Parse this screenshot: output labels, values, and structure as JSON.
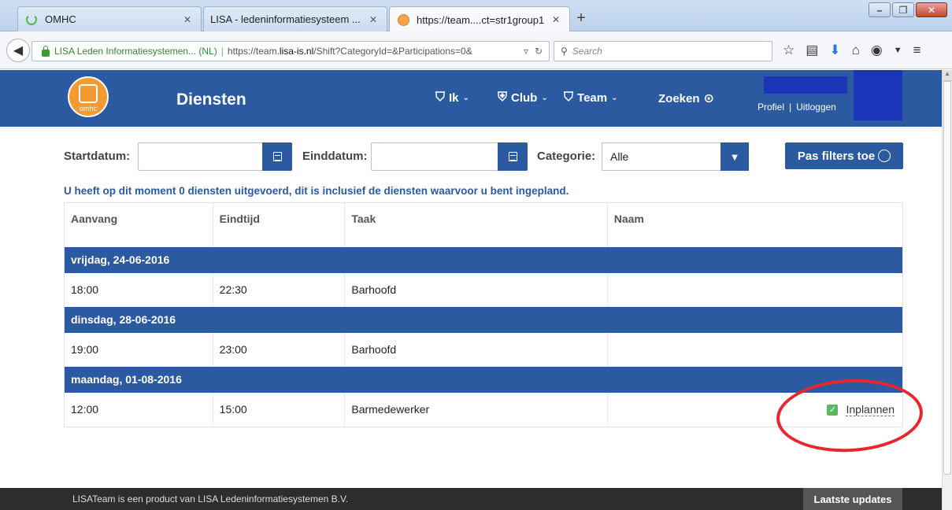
{
  "browser": {
    "tabs": [
      {
        "label": "OMHC",
        "icon": "loading-spinner-icon"
      },
      {
        "label": "LISA - ledeninformatiesysteem ...",
        "icon": "none"
      },
      {
        "label": "https://team....ct=str1group1",
        "icon": "omhc-favicon"
      }
    ],
    "new_tab": "+",
    "site_identity": "LISA Leden Informatiesystemen... (NL)",
    "url_prefix": "https://team.",
    "url_domain": "lisa-is.nl",
    "url_rest": "/Shift?CategoryId=&Participations=0&",
    "search_placeholder": "Search"
  },
  "header": {
    "logo_text": "omhc",
    "page_title": "Diensten",
    "menu": [
      {
        "label": "Ik",
        "icon": "shirt-icon"
      },
      {
        "label": "Club",
        "icon": "shield-icon"
      },
      {
        "label": "Team",
        "icon": "team-shirts-icon"
      }
    ],
    "search_label": "Zoeken",
    "profile": "Profiel",
    "separator": "|",
    "logout": "Uitloggen"
  },
  "filters": {
    "start_label": "Startdatum:",
    "start_value": "",
    "end_label": "Einddatum:",
    "end_value": "",
    "category_label": "Categorie:",
    "category_value": "Alle",
    "apply_label": "Pas filters toe"
  },
  "notice": "U heeft op dit moment 0 diensten uitgevoerd, dit is inclusief de diensten waarvoor u bent ingepland.",
  "table": {
    "headers": [
      "Aanvang",
      "Eindtijd",
      "Taak",
      "Naam"
    ],
    "groups": [
      {
        "date": "vrijdag, 24-06-2016",
        "start": "18:00",
        "end": "22:30",
        "task": "Barhoofd",
        "name": ""
      },
      {
        "date": "dinsdag, 28-06-2016",
        "start": "19:00",
        "end": "23:00",
        "task": "Barhoofd",
        "name": ""
      },
      {
        "date": "maandag, 01-08-2016",
        "start": "12:00",
        "end": "15:00",
        "task": "Barmedewerker",
        "name": "",
        "action": "Inplannen"
      }
    ]
  },
  "footer": {
    "text": "LISATeam is een product van LISA Ledeninformatiesystemen B.V.",
    "button": "Laatste updates"
  },
  "colors": {
    "brand_blue": "#2b5aa0",
    "logo_orange": "#f39a33",
    "annotation_red": "#e8262b",
    "check_green": "#5cb85c"
  }
}
